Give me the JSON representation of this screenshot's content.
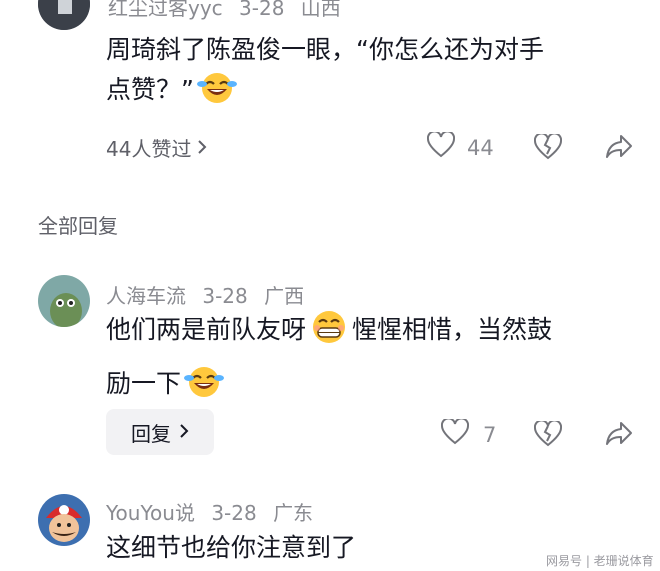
{
  "comment1": {
    "username": "红尘过客yyc",
    "date": "3-28",
    "location": "山西",
    "text_line1": "周琦斜了陈盈俊一眼，“你怎么还为对手",
    "text_line2": "点赞？”",
    "likes_summary": "44人赞过",
    "like_count": "44"
  },
  "section": {
    "all_replies_label": "全部回复"
  },
  "comment2": {
    "username": "人海车流",
    "date": "3-28",
    "location": "广西",
    "text_line1_a": "他们两是前队友呀",
    "text_line1_b": "惺惺相惜，当然鼓",
    "text_line2": "励一下",
    "reply_label": "回复",
    "like_count": "7"
  },
  "comment3": {
    "username": "YouYou说",
    "date": "3-28",
    "location": "广东",
    "text": "这细节也给你注意到了"
  },
  "watermark": {
    "text": "网易号 | 老珊说体育"
  },
  "colors": {
    "text": "#161823",
    "meta": "#8a8b91",
    "reply_bg": "#f2f2f4"
  }
}
